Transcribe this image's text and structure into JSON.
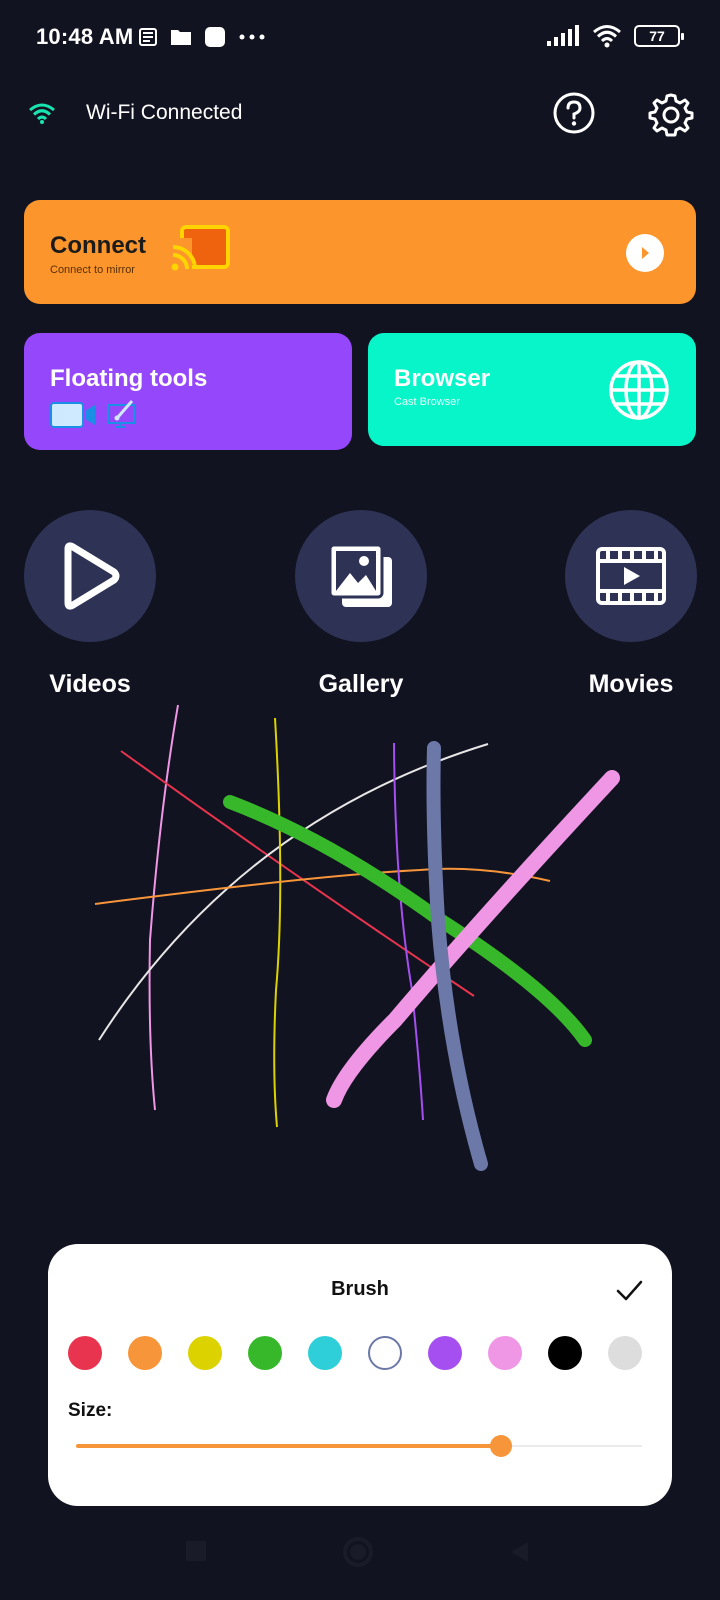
{
  "status_bar": {
    "time": "10:48 AM",
    "battery": "77",
    "icons": [
      "news-icon",
      "folder-icon",
      "app-icon",
      "more-dots-icon",
      "signal-icon",
      "wifi-icon",
      "battery-icon"
    ]
  },
  "header": {
    "wifi_label": "Wi-Fi Connected",
    "icons": [
      "wifi-icon",
      "help-icon",
      "settings-icon"
    ]
  },
  "connect_card": {
    "title": "Connect",
    "subtitle": "Connect to mirror",
    "color": "#fb952c"
  },
  "floating_card": {
    "title": "Floating tools",
    "color": "#9547fb"
  },
  "browser_card": {
    "title": "Browser",
    "subtitle": "Cast Browser",
    "color": "#07f5c8"
  },
  "media": [
    {
      "label": "Videos",
      "icon": "play-icon"
    },
    {
      "label": "Gallery",
      "icon": "gallery-icon"
    },
    {
      "label": "Movies",
      "icon": "movie-icon"
    }
  ],
  "brush_panel": {
    "title": "Brush",
    "size_label": "Size:",
    "size_value": 0.75,
    "colors": [
      "#e8344e",
      "#f7953a",
      "#dcd200",
      "#37b82a",
      "#2ecfd9",
      "#ffffff",
      "#a54ff0",
      "#ef96e5",
      "#000000",
      "#dddddd"
    ],
    "selected_index": 5
  },
  "accent_colors": {
    "background": "#121320",
    "circle": "#2e3356",
    "wifi": "#18e4b0"
  }
}
